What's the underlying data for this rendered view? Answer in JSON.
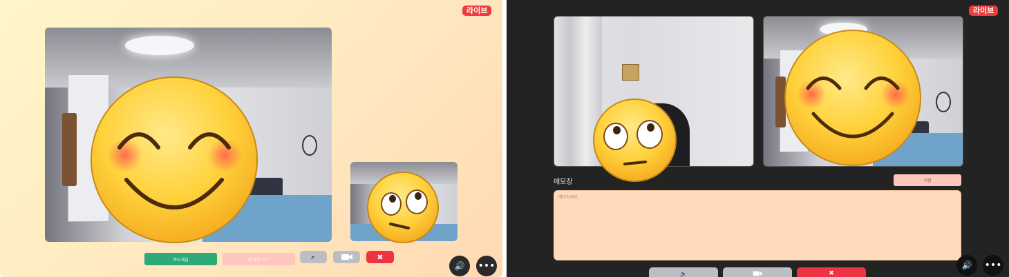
{
  "left_panel": {
    "live_badge": "라이브",
    "buttons": {
      "card_game": "카드게임",
      "my_screen": "내 화면 보기"
    },
    "icons": [
      "speaker-icon",
      "camera-icon",
      "close-icon",
      "speaker-icon",
      "more-icon"
    ],
    "colors": {
      "card_game": "#2eaa79",
      "my_screen": "#ffc6bd",
      "end_call": "#ee3442",
      "live": "#ec3d3d"
    }
  },
  "right_panel": {
    "live_badge": "라이브",
    "memo": {
      "title": "메모장",
      "save_label": "저장",
      "placeholder": "메모하세요."
    },
    "icons": [
      "speaker-icon",
      "camera-icon",
      "close-icon",
      "speaker-icon",
      "more-icon"
    ],
    "colors": {
      "memo_bg": "#ffdbbb",
      "save": "#ffc6bd",
      "end_call": "#ee3442"
    }
  }
}
